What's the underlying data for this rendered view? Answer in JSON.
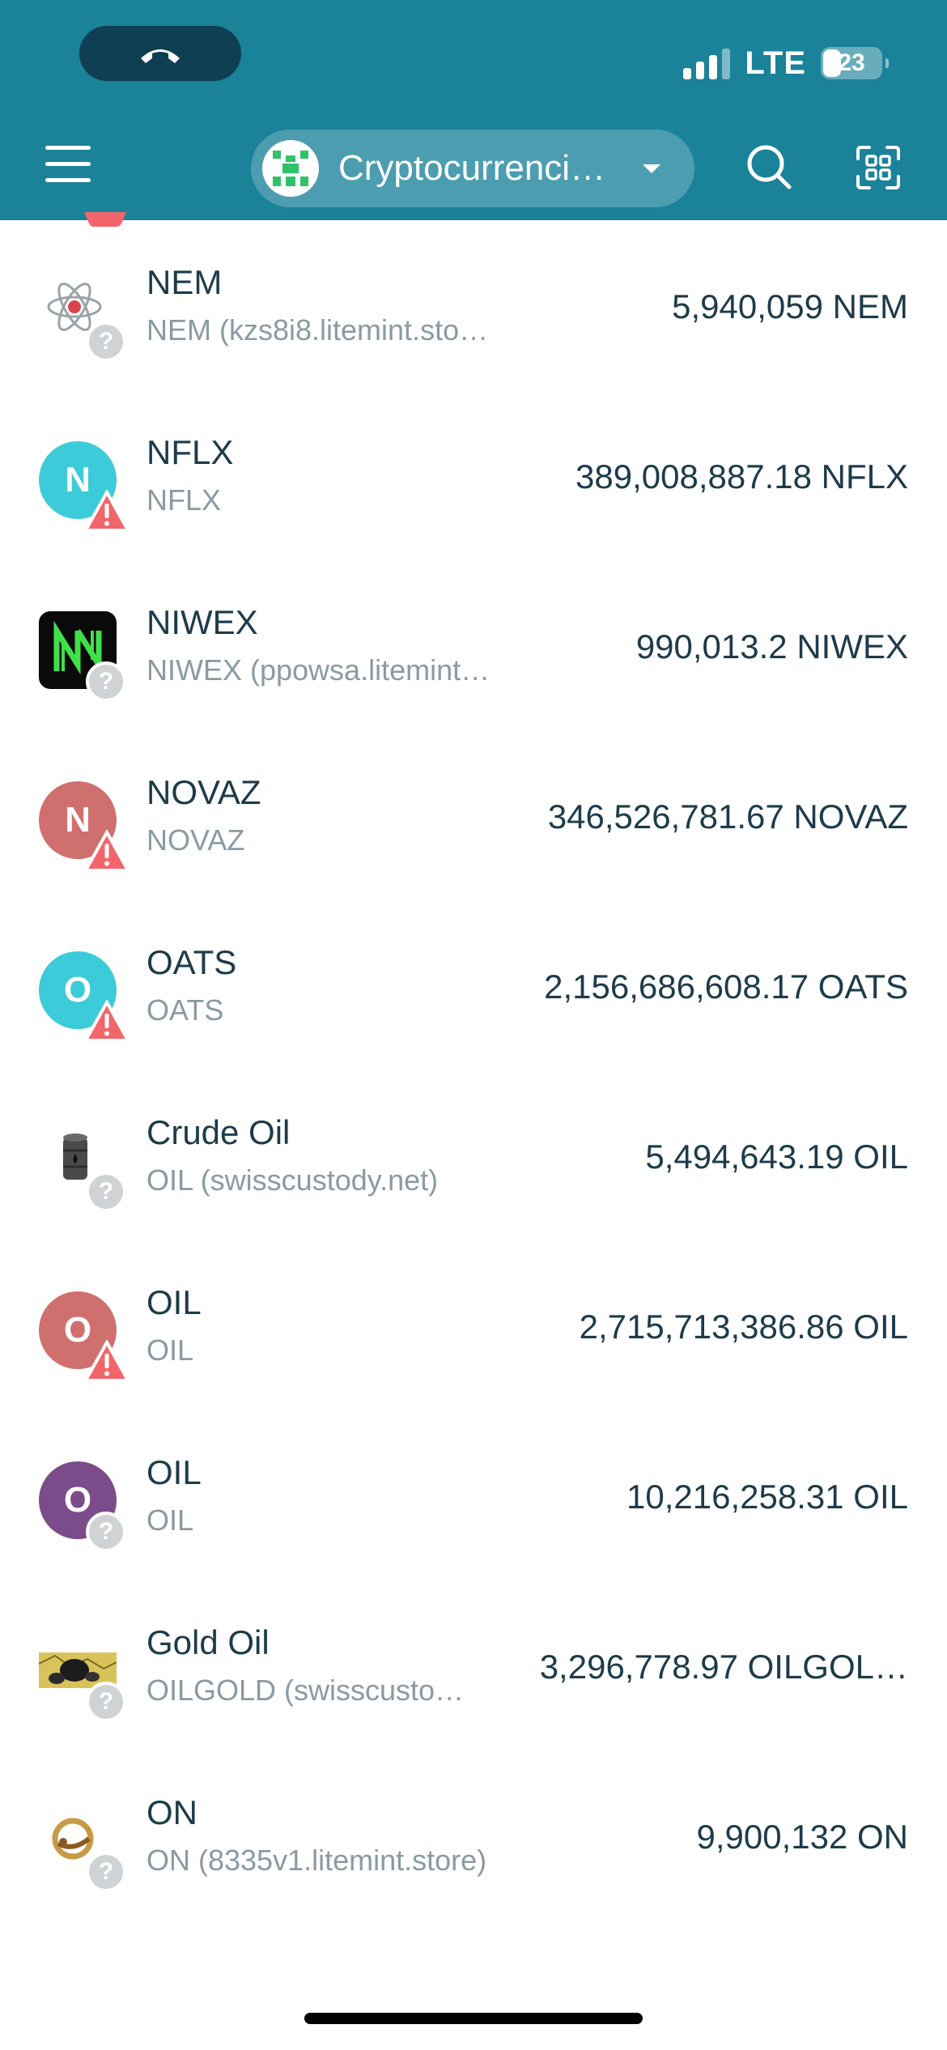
{
  "status_bar": {
    "network": "LTE",
    "battery": "23"
  },
  "header": {
    "network_selector": "Cryptocurrenci…"
  },
  "tokens": [
    {
      "name": "NEM",
      "sub": "NEM (kzs8i8.litemint.store)",
      "balance": "5,940,059 NEM",
      "icon": "atom-icon",
      "badge": "question"
    },
    {
      "name": "NFLX",
      "sub": "NFLX",
      "balance": "389,008,887.18 NFLX",
      "icon": "letter-avatar",
      "letter": "N",
      "color": "#3ccbd8",
      "badge": "warning"
    },
    {
      "name": "NIWEX",
      "sub": "NIWEX (ppowsa.litemint.store)",
      "balance": "990,013.2 NIWEX",
      "icon": "niwex-logo-icon",
      "badge": "question"
    },
    {
      "name": "NOVAZ",
      "sub": "NOVAZ",
      "balance": "346,526,781.67 NOVAZ",
      "icon": "letter-avatar",
      "letter": "N",
      "color": "#d0706e",
      "badge": "warning"
    },
    {
      "name": "OATS",
      "sub": "OATS",
      "balance": "2,156,686,608.17 OATS",
      "icon": "letter-avatar",
      "letter": "O",
      "color": "#3ccbd8",
      "badge": "warning"
    },
    {
      "name": "Crude Oil",
      "sub": "OIL (swisscustody.net)",
      "balance": "5,494,643.19 OIL",
      "icon": "oil-barrel-icon",
      "badge": "question"
    },
    {
      "name": "OIL",
      "sub": "OIL",
      "balance": "2,715,713,386.86 OIL",
      "icon": "letter-avatar",
      "letter": "O",
      "color": "#d0706e",
      "badge": "warning"
    },
    {
      "name": "OIL",
      "sub": "OIL",
      "balance": "10,216,258.31 OIL",
      "icon": "letter-avatar",
      "letter": "O",
      "color": "#7b4b8a",
      "badge": "question"
    },
    {
      "name": "Gold Oil",
      "sub": "OILGOLD (swisscusto…",
      "balance": "3,296,778.97 OILGOL…",
      "icon": "gold-oil-icon",
      "badge": "question"
    },
    {
      "name": "ON",
      "sub": "ON (8335v1.litemint.store)",
      "balance": "9,900,132 ON",
      "icon": "on-ring-icon",
      "badge": "question"
    }
  ],
  "colors": {
    "header": "#1a8299",
    "warning": "#f2656a",
    "text": "#1d3b4a",
    "subtext": "#8a9aa3"
  }
}
